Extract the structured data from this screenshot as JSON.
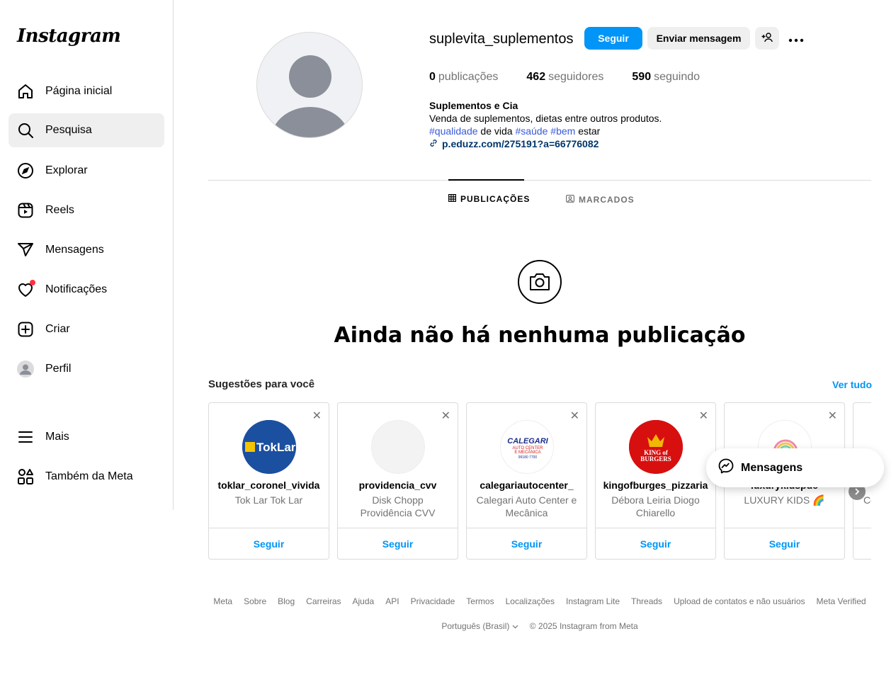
{
  "sidebar": {
    "logo": "Instagram",
    "items": [
      {
        "label": "Página inicial",
        "icon": "home-icon"
      },
      {
        "label": "Pesquisa",
        "icon": "search-icon"
      },
      {
        "label": "Explorar",
        "icon": "compass-icon"
      },
      {
        "label": "Reels",
        "icon": "reels-icon"
      },
      {
        "label": "Mensagens",
        "icon": "send-icon"
      },
      {
        "label": "Notificações",
        "icon": "heart-icon"
      },
      {
        "label": "Criar",
        "icon": "plus-square-icon"
      },
      {
        "label": "Perfil",
        "icon": "profile-avatar-icon"
      }
    ],
    "more": "Mais",
    "meta": "Também da Meta"
  },
  "profile": {
    "username": "suplevita_suplementos",
    "follow_label": "Seguir",
    "message_label": "Enviar mensagem",
    "stats": {
      "posts_count": "0",
      "posts_label": "publicações",
      "followers_count": "462",
      "followers_label": "seguidores",
      "following_count": "590",
      "following_label": "seguindo"
    },
    "bio": {
      "name": "Suplementos e Cia",
      "line1": "Venda de suplementos, dietas entre outros produtos.",
      "tag1": "#qualidade",
      "text1": "de vida",
      "tag2": "#saúde",
      "tag3": "#bem",
      "text2": "estar",
      "link": "p.eduzz.com/275191?a=66776082"
    }
  },
  "tabs": {
    "posts": "PUBLICAÇÕES",
    "tagged": "MARCADOS"
  },
  "empty_state": {
    "title": "Ainda não há nenhuma publicação"
  },
  "suggestions": {
    "title": "Sugestões para você",
    "see_all": "Ver tudo",
    "follow_label": "Seguir",
    "cards": [
      {
        "username": "toklar_coronel_vivida",
        "subtitle": "Tok Lar Tok Lar"
      },
      {
        "username": "providencia_cvv",
        "subtitle": "Disk Chopp Providência CVV"
      },
      {
        "username": "calegariautocenter_",
        "subtitle": "Calegari Auto Center e Mecânica"
      },
      {
        "username": "kingofburges_pizzaria",
        "subtitle": "Débora Leiria Diogo Chiarello"
      },
      {
        "username": "luxurykidspdc",
        "subtitle": "LUXURY KIDS 🌈"
      },
      {
        "username": "",
        "subtitle": "Co"
      }
    ],
    "logos": {
      "toklar": "TokLar",
      "calegari_line1": "CALEGARI",
      "calegari_line2": "AUTO CENTER",
      "calegari_line3": "E MECÂNICA",
      "calegari_phone": "99180 7700",
      "king_line1": "KING of",
      "king_line2": "BURGERS"
    }
  },
  "messages_float": {
    "label": "Mensagens"
  },
  "footer": {
    "links": [
      "Meta",
      "Sobre",
      "Blog",
      "Carreiras",
      "Ajuda",
      "API",
      "Privacidade",
      "Termos",
      "Localizações",
      "Instagram Lite",
      "Threads",
      "Upload de contatos e não usuários",
      "Meta Verified"
    ],
    "language": "Português (Brasil)",
    "copyright": "© 2025 Instagram from Meta"
  }
}
